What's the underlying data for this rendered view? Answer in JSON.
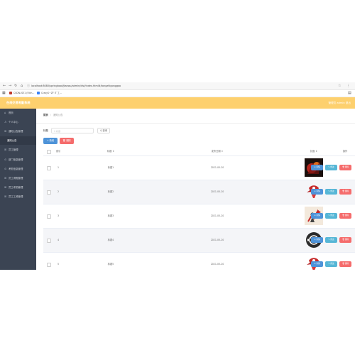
{
  "browser": {
    "url": "localhost:8080/springboot/jiaowu/admin/dist/index.html#/tongzhigonggao",
    "nav": {
      "back": "←",
      "forward": "→",
      "reload": "↻",
      "home": "⌂"
    },
    "bookmarks": [
      {
        "label": "CSDN-ISE1 (Rich...",
        "icon_color": "#c0392b"
      },
      {
        "label": "CrazyS~ZF IT 工...",
        "icon_color": "#3b82f6"
      }
    ]
  },
  "app": {
    "title": "在线交易考勤系统",
    "header_right": "管理员 admin   退出"
  },
  "sidebar": {
    "items": [
      {
        "icon": "⌂",
        "label": "首页",
        "icon_name": "home-icon"
      },
      {
        "icon": "♙",
        "label": "个人中心",
        "icon_name": "user-icon"
      },
      {
        "icon": "⊞",
        "label": "通知公告管理",
        "icon_name": "grid-icon"
      },
      {
        "icon": "",
        "label": "通知公告",
        "icon_name": "",
        "active": true
      },
      {
        "icon": "⊞",
        "label": "员工管理",
        "icon_name": "grid-icon"
      },
      {
        "icon": "⊙",
        "label": "部门信息管理",
        "icon_name": "circle-icon"
      },
      {
        "icon": "⊙",
        "label": "考勤信息管理",
        "icon_name": "circle-icon"
      },
      {
        "icon": "⊞",
        "label": "员工请假管理",
        "icon_name": "grid-icon"
      },
      {
        "icon": "⊞",
        "label": "员工考勤管理",
        "icon_name": "grid-icon"
      },
      {
        "icon": "⊞",
        "label": "员工工资管理",
        "icon_name": "grid-icon"
      }
    ]
  },
  "breadcrumb": {
    "home": "首页",
    "separator": "/",
    "current": "通知公告"
  },
  "search": {
    "label": "标题",
    "placeholder": "⚲ 标题",
    "button": "⚲ 查询"
  },
  "actions": {
    "add": "+ 新增",
    "delete": "🗑 删除"
  },
  "table": {
    "headers": {
      "index": "索引",
      "title": "标题 ⇕",
      "date": "发布日期 ⇕",
      "image": "封面 ⇕",
      "ops": "操作"
    },
    "rows": [
      {
        "index": "1",
        "title": "标题1",
        "date": "2021-05-20"
      },
      {
        "index": "2",
        "title": "标题2",
        "date": "2021-05-20"
      },
      {
        "index": "3",
        "title": "标题3",
        "date": "2021-05-20"
      },
      {
        "index": "4",
        "title": "标题4",
        "date": "2021-05-20"
      },
      {
        "index": "5",
        "title": "标题5",
        "date": "2021-05-20"
      }
    ],
    "row_buttons": {
      "detail": "⊙ 详情",
      "edit": "✎ 修改",
      "delete": "🗑 删除"
    }
  },
  "colors": {
    "header": "#fdd06e",
    "sidebar": "#3b4453",
    "primary": "#4e93d8",
    "danger": "#f56c6c",
    "info": "#56b6d6"
  }
}
